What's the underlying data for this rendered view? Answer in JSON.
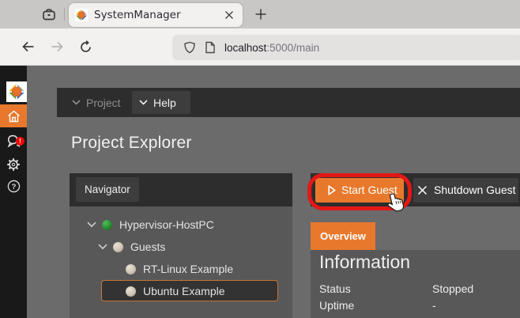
{
  "browser": {
    "tab_title": "SystemManager",
    "url_host": "localhost",
    "url_rest": ":5000/main"
  },
  "sidebar": {
    "notification_badge": "!"
  },
  "menubar": {
    "items": [
      {
        "label": "Project"
      },
      {
        "label": "Help"
      }
    ]
  },
  "page": {
    "title": "Project Explorer"
  },
  "navigator": {
    "title": "Navigator",
    "tree": [
      {
        "label": "Hypervisor-HostPC",
        "state": "online",
        "expanded": true
      },
      {
        "label": "Guests",
        "state": "offline",
        "expanded": true
      },
      {
        "label": "RT-Linux Example",
        "state": "offline"
      },
      {
        "label": "Ubuntu Example",
        "state": "offline",
        "selected": true
      }
    ]
  },
  "actions": {
    "start_label": "Start Guest",
    "shutdown_label": "Shutdown Guest"
  },
  "tabs": {
    "overview_label": "Overview"
  },
  "info": {
    "title": "Information",
    "rows": [
      {
        "label": "Status",
        "value": "Stopped"
      },
      {
        "label": "Uptime",
        "value": "-"
      }
    ]
  },
  "colors": {
    "accent": "#e8792c",
    "annotation": "#e41717",
    "badge": "#e01414",
    "online": "#2f9e38",
    "offline": "#d2c9bb"
  }
}
